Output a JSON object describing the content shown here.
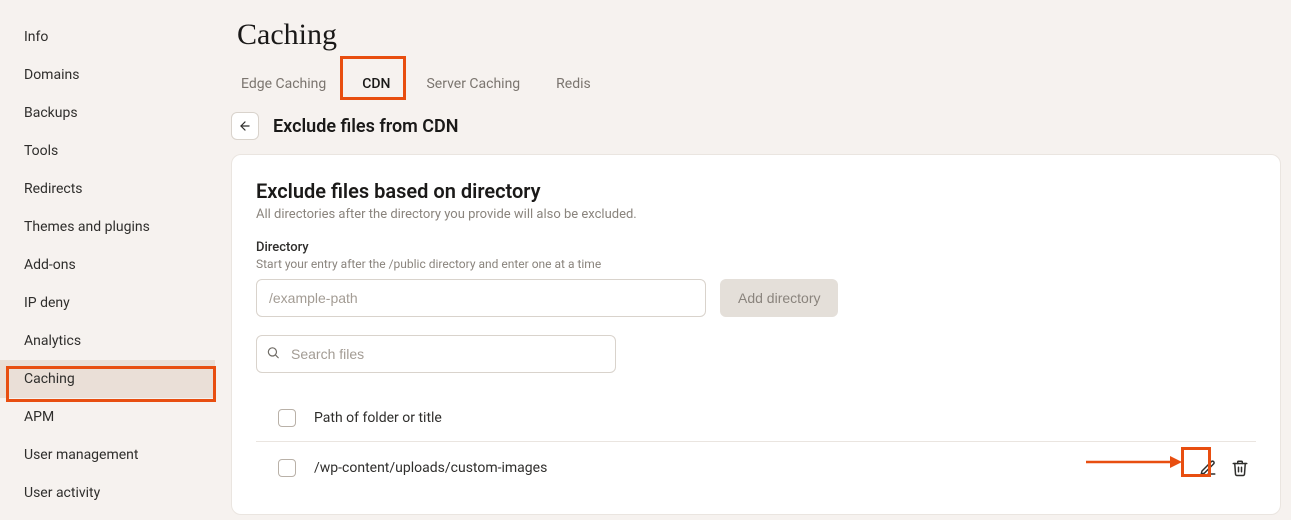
{
  "sidebar": {
    "items": [
      {
        "label": "Info"
      },
      {
        "label": "Domains"
      },
      {
        "label": "Backups"
      },
      {
        "label": "Tools"
      },
      {
        "label": "Redirects"
      },
      {
        "label": "Themes and plugins"
      },
      {
        "label": "Add-ons"
      },
      {
        "label": "IP deny"
      },
      {
        "label": "Analytics"
      },
      {
        "label": "Caching",
        "active": true
      },
      {
        "label": "APM"
      },
      {
        "label": "User management"
      },
      {
        "label": "User activity"
      }
    ]
  },
  "page": {
    "title": "Caching"
  },
  "tabs": [
    {
      "label": "Edge Caching"
    },
    {
      "label": "CDN",
      "active": true
    },
    {
      "label": "Server Caching"
    },
    {
      "label": "Redis"
    }
  ],
  "subheader": {
    "title": "Exclude files from CDN"
  },
  "card": {
    "title": "Exclude files based on directory",
    "desc": "All directories after the directory you provide will also be excluded.",
    "dir_label": "Directory",
    "dir_help": "Start your entry after the /public directory and enter one at a time",
    "dir_placeholder": "/example-path",
    "add_label": "Add directory",
    "search_placeholder": "Search files",
    "header_label": "Path of folder or title",
    "rows": [
      {
        "path": "/wp-content/uploads/custom-images"
      }
    ]
  }
}
